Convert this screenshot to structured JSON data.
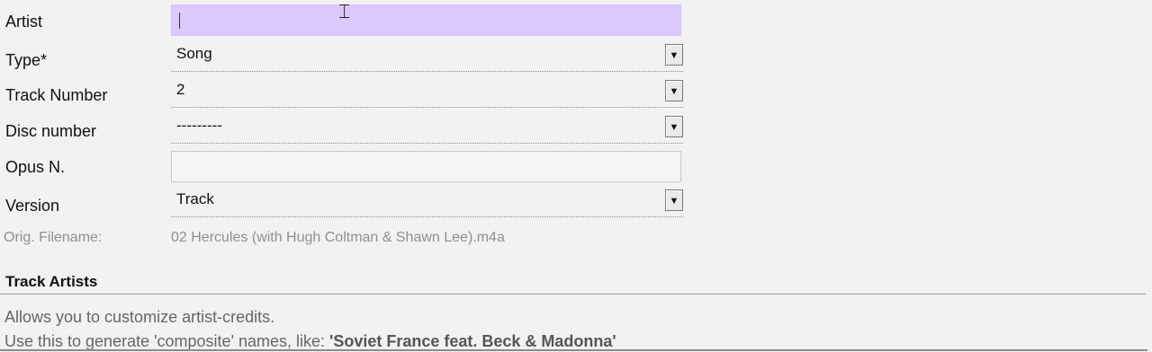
{
  "fields": {
    "artist": {
      "label": "Artist",
      "value": ""
    },
    "type": {
      "label": "Type*",
      "value": "Song"
    },
    "track_number": {
      "label": "Track Number",
      "value": "2"
    },
    "disc_number": {
      "label": "Disc number",
      "value": "---------"
    },
    "opus": {
      "label": "Opus N.",
      "value": ""
    },
    "version": {
      "label": "Version",
      "value": "Track"
    },
    "orig_filename": {
      "label": "Orig. Filename:",
      "value": "02 Hercules (with Hugh Coltman & Shawn Lee).m4a"
    }
  },
  "section": {
    "title": "Track Artists",
    "help_line1": "Allows you to customize artist-credits.",
    "help_line2_prefix": "Use this to generate 'composite' names, like: ",
    "help_line2_example": "'Soviet France feat. Beck & Madonna'"
  },
  "icons": {
    "dropdown_arrow": "▼",
    "text_cursor": "⌶"
  },
  "colors": {
    "active_input_bg": "#dccaff",
    "page_bg": "#f2f2f2",
    "muted_text": "#8f8f8f"
  }
}
